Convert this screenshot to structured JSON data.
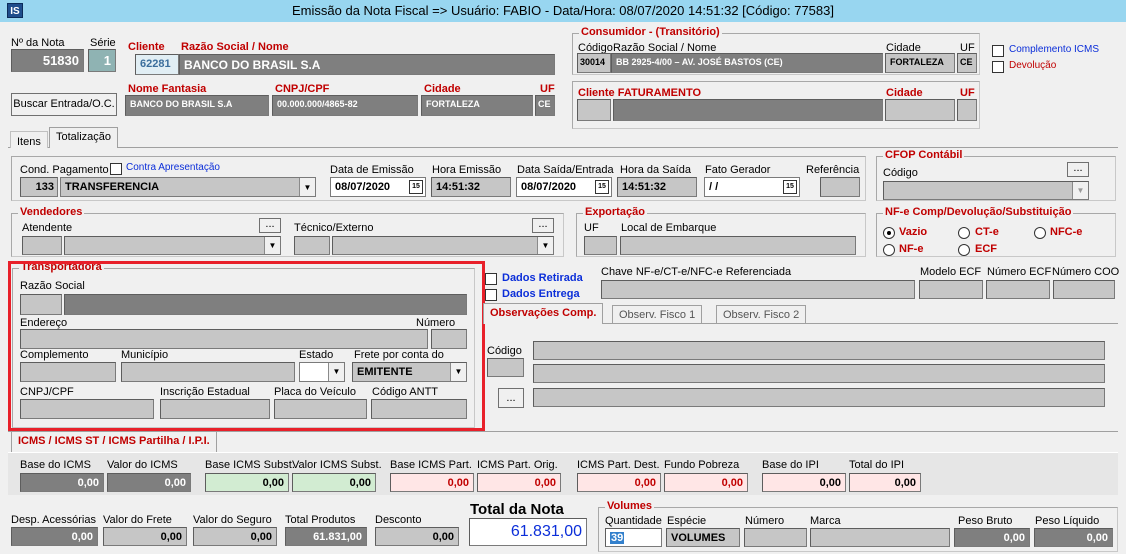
{
  "window": {
    "title": "Emissão da Nota Fiscal  => Usuário: FABIO - Data/Hora: 08/07/2020 14:51:32  [Código: 77583]",
    "icon": "app-logo-icon"
  },
  "header": {
    "nota_label": "Nº da Nota",
    "nota_value": "51830",
    "serie_label": "Série",
    "serie_value": "1",
    "cliente_label": "Cliente",
    "razao_label": "Razão Social / Nome",
    "cliente_code": "62281",
    "cliente_name": "BANCO DO BRASIL S.A",
    "fantasia_label": "Nome Fantasia",
    "fantasia_value": "BANCO DO BRASIL S.A",
    "cnpj_label": "CNPJ/CPF",
    "cnpj_value": "00.000.000/4865-82",
    "cidade_label": "Cidade",
    "cidade_value": "FORTALEZA",
    "uf_label": "UF",
    "uf_value": "CE",
    "buscar_button": "Buscar Entrada/O.C."
  },
  "consumidor": {
    "title": "Consumidor - (Transitório)",
    "codigo_label": "Código",
    "razao_label": "Razão Social / Nome",
    "cidade_label": "Cidade",
    "uf_label": "UF",
    "codigo_value": "30014",
    "razao_value": "BB 2925-4/00 – AV. JOSÉ BASTOS (CE)",
    "cidade_value": "FORTALEZA",
    "uf_value": "CE"
  },
  "faturamento": {
    "label": "Cliente FATURAMENTO",
    "cidade_label": "Cidade",
    "uf_label": "UF"
  },
  "checks": {
    "complemento_icms": "Complemento ICMS",
    "devolucao": "Devolução"
  },
  "tabs": [
    "Itens",
    "Totalização"
  ],
  "pagamento": {
    "cond_label": "Cond. Pagamento",
    "contra_label": "Contra Apresentação",
    "cond_code": "133",
    "cond_value": "TRANSFERENCIA",
    "emissao_label": "Data de Emissão",
    "emissao_value": "08/07/2020",
    "hora_emissao_label": "Hora Emissão",
    "hora_emissao_value": "14:51:32",
    "saida_label": "Data Saída/Entrada",
    "saida_value": "08/07/2020",
    "hora_saida_label": "Hora da Saída",
    "hora_saida_value": "14:51:32",
    "fato_label": "Fato Gerador",
    "fato_value": "/ /",
    "referencia_label": "Referência"
  },
  "cfop": {
    "title": "CFOP Contábil",
    "codigo_label": "Código",
    "btn": "..."
  },
  "vendedores": {
    "title": "Vendedores",
    "atendente_label": "Atendente",
    "tecnico_label": "Técnico/Externo",
    "btn": "..."
  },
  "exportacao": {
    "title": "Exportação",
    "uf_label": "UF",
    "local_label": "Local de Embarque"
  },
  "nfe_comp": {
    "title": "NF-e Comp/Devolução/Substituição",
    "options": [
      "Vazio",
      "CT-e",
      "NFC-e",
      "NF-e",
      "ECF"
    ],
    "selected": "Vazio"
  },
  "transportadora": {
    "title": "Transportadora",
    "razao_label": "Razão Social",
    "endereco_label": "Endereço",
    "numero_label": "Número",
    "complemento_label": "Complemento",
    "municipio_label": "Município",
    "estado_label": "Estado",
    "frete_label": "Frete por conta do",
    "frete_value": "EMITENTE",
    "cnpj_label": "CNPJ/CPF",
    "ie_label": "Inscrição Estadual",
    "placa_label": "Placa do Veículo",
    "antt_label": "Código ANTT"
  },
  "dados": {
    "retirada": "Dados Retirada",
    "entrega": "Dados Entrega"
  },
  "referenciada": {
    "chave_label": "Chave NF-e/CT-e/NFC-e Referenciada",
    "modelo_label": "Modelo ECF",
    "numero_label": "Número ECF",
    "coo_label": "Número COO"
  },
  "obs_tabs": [
    "Observações Comp.",
    "Observ. Fisco 1",
    "Observ. Fisco 2"
  ],
  "obs": {
    "codigo_label": "Código",
    "btn": "..."
  },
  "icms": {
    "section_title": "ICMS / ICMS ST / ICMS Partilha / I.P.I.",
    "fields": [
      {
        "label": "Base do ICMS",
        "value": "0,00"
      },
      {
        "label": "Valor do ICMS",
        "value": "0,00"
      },
      {
        "label": "Base ICMS Subst.",
        "value": "0,00"
      },
      {
        "label": "Valor ICMS Subst.",
        "value": "0,00"
      },
      {
        "label": "Base ICMS Part.",
        "value": "0,00"
      },
      {
        "label": "ICMS Part. Orig.",
        "value": "0,00"
      },
      {
        "label": "ICMS Part. Dest.",
        "value": "0,00"
      },
      {
        "label": "Fundo Pobreza",
        "value": "0,00"
      },
      {
        "label": "Base do IPI",
        "value": "0,00"
      },
      {
        "label": "Total do IPI",
        "value": "0,00"
      }
    ]
  },
  "totais": {
    "desp_label": "Desp. Acessórias",
    "desp_value": "0,00",
    "frete_label": "Valor do Frete",
    "frete_value": "0,00",
    "seguro_label": "Valor do Seguro",
    "seguro_value": "0,00",
    "produtos_label": "Total Produtos",
    "produtos_value": "61.831,00",
    "desconto_label": "Desconto",
    "desconto_value": "0,00",
    "total_label": "Total da Nota",
    "total_value": "61.831,00"
  },
  "volumes": {
    "title": "Volumes",
    "quantidade_label": "Quantidade",
    "quantidade_value": "39",
    "especie_label": "Espécie",
    "especie_value": "VOLUMES",
    "numero_label": "Número",
    "marca_label": "Marca",
    "peso_bruto_label": "Peso Bruto",
    "peso_bruto_value": "0,00",
    "peso_liquido_label": "Peso Líquido",
    "peso_liquido_value": "0,00"
  }
}
